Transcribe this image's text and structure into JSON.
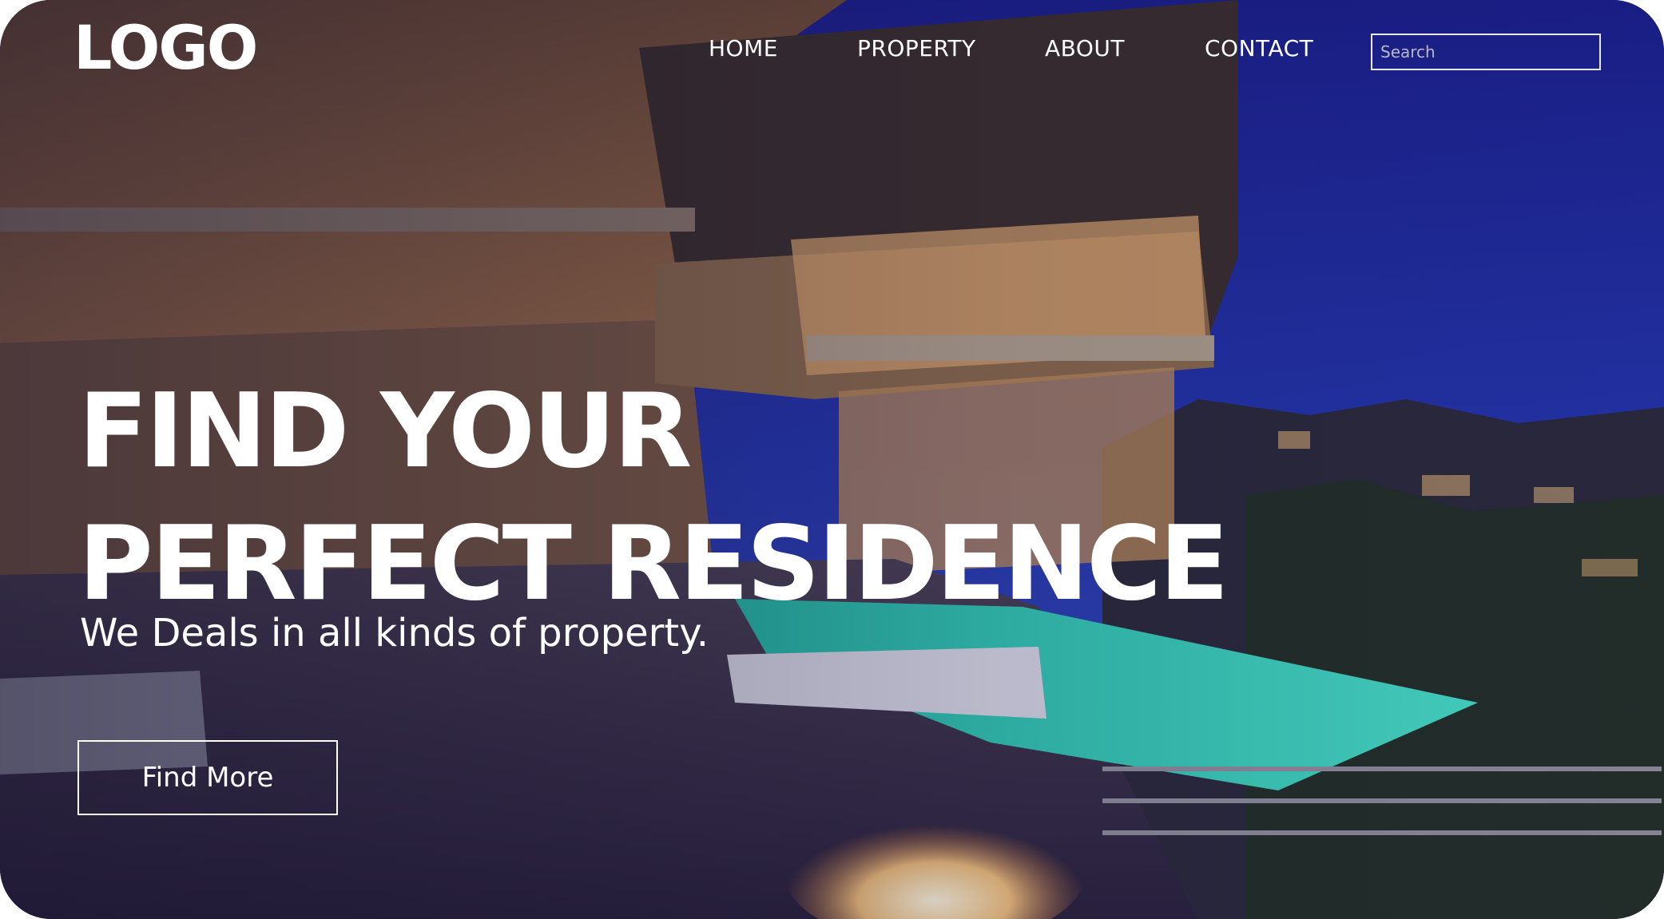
{
  "brand": {
    "logo_text": "LOGO"
  },
  "nav": {
    "items": [
      {
        "label": "HOME"
      },
      {
        "label": "PROPERTY"
      },
      {
        "label": "ABOUT"
      },
      {
        "label": "CONTACT"
      }
    ]
  },
  "search": {
    "placeholder": "Search"
  },
  "hero": {
    "title_line1": "FIND YOUR",
    "title_line2": "PERFECT RESIDENCE",
    "subtitle": "We Deals in all kinds of property.",
    "cta_label": "Find More"
  },
  "colors": {
    "text": "#ffffff",
    "night_sky": "#1f2c9e",
    "pool": "#3ee0c8",
    "interior_glow": "#e8a864",
    "overlay": "#1a1433"
  }
}
